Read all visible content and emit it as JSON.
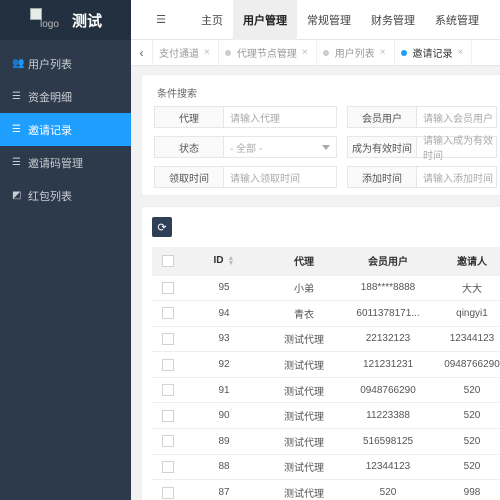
{
  "app": {
    "logo_alt": "logo",
    "title": "测试"
  },
  "sidebar": {
    "items": [
      {
        "icon": "users-icon",
        "glyph": "👥",
        "label": "用户列表",
        "active": false
      },
      {
        "icon": "list-icon",
        "glyph": "☰",
        "label": "资金明细",
        "active": false
      },
      {
        "icon": "list-icon",
        "glyph": "☰",
        "label": "邀请记录",
        "active": true
      },
      {
        "icon": "list-icon",
        "glyph": "☰",
        "label": "邀请码管理",
        "active": false
      },
      {
        "icon": "redpacket-icon",
        "glyph": "◩",
        "label": "红包列表",
        "active": false
      }
    ]
  },
  "topbar": {
    "menu_glyph": "☰",
    "nav": [
      "主页",
      "用户管理",
      "常规管理",
      "财务管理",
      "系统管理"
    ],
    "active_nav": "用户管理"
  },
  "tabs": {
    "items": [
      {
        "label": "支付通道",
        "active": false,
        "dot": false
      },
      {
        "label": "代理节点管理",
        "active": false,
        "dot": true
      },
      {
        "label": "用户列表",
        "active": false,
        "dot": true
      },
      {
        "label": "邀请记录",
        "active": true,
        "dot": true
      }
    ]
  },
  "filter": {
    "legend": "条件搜索",
    "fields": {
      "agent": {
        "label": "代理",
        "placeholder": "请输入代理"
      },
      "member": {
        "label": "会员用户",
        "placeholder": "请输入会员用户"
      },
      "status": {
        "label": "状态",
        "value": "- 全部 -"
      },
      "valid_time": {
        "label": "成为有效时间",
        "placeholder": "请输入成为有效时间"
      },
      "claim_time": {
        "label": "领取时间",
        "placeholder": "请输入领取时间"
      },
      "add_time": {
        "label": "添加时间",
        "placeholder": "请输入添加时间"
      }
    }
  },
  "table": {
    "columns": [
      "",
      "ID",
      "代理",
      "会员用户",
      "邀请人"
    ],
    "rows": [
      [
        "95",
        "小弟",
        "188****8888",
        "大大"
      ],
      [
        "94",
        "青衣",
        "6011378171...",
        "qingyi1"
      ],
      [
        "93",
        "测试代理",
        "22132123",
        "12344123"
      ],
      [
        "92",
        "测试代理",
        "121231231",
        "0948766290"
      ],
      [
        "91",
        "测试代理",
        "0948766290",
        "520"
      ],
      [
        "90",
        "测试代理",
        "11223388",
        "520"
      ],
      [
        "89",
        "测试代理",
        "516598125",
        "520"
      ],
      [
        "88",
        "测试代理",
        "12344123",
        "520"
      ],
      [
        "87",
        "测试代理",
        "520",
        "998"
      ]
    ]
  },
  "colors": {
    "sidebar_bg": "#2d3a4b",
    "accent": "#1e9fff",
    "refresh_btn": "#2f4056"
  }
}
